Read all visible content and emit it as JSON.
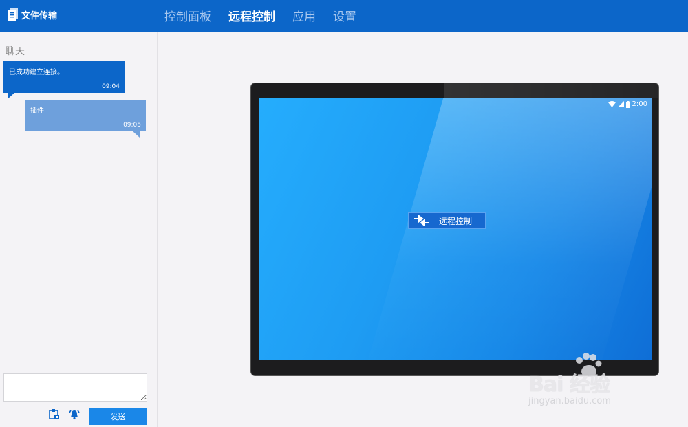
{
  "app": {
    "title": "文件传输"
  },
  "nav": {
    "tabs": [
      {
        "label": "控制面板"
      },
      {
        "label": "远程控制"
      },
      {
        "label": "应用"
      },
      {
        "label": "设置"
      }
    ]
  },
  "chat": {
    "title": "聊天",
    "messages": [
      {
        "text": "已成功建立连接。",
        "time": "09:04"
      },
      {
        "text": "插件",
        "time": "09:05"
      }
    ],
    "input_value": "",
    "send_label": "发送"
  },
  "device": {
    "status_time": "2:00",
    "remote_button_label": "远程控制"
  },
  "watermark": {
    "brand": "Bai 经验",
    "url": "jingyan.baidu.com"
  },
  "colors": {
    "header": "#0c66c9",
    "accent": "#1a87e8"
  },
  "icons": [
    "document-icon",
    "file-transfer-icon",
    "alarm-icon",
    "wifi-icon",
    "signal-icon",
    "battery-icon",
    "swap-arrows-icon",
    "paw-icon"
  ]
}
